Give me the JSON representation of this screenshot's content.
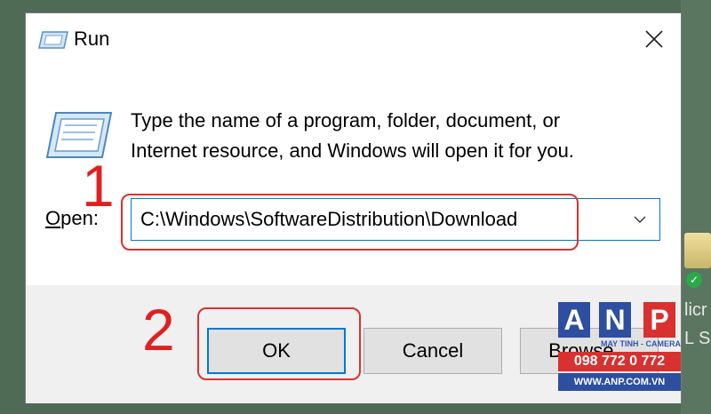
{
  "window": {
    "title": "Run",
    "description_line1": "Type the name of a program, folder, document, or",
    "description_line2": "Internet resource, and Windows will open it for you."
  },
  "open_field": {
    "label_accel": "O",
    "label_rest": "pen:",
    "value": "C:\\Windows\\SoftwareDistribution\\Download"
  },
  "buttons": {
    "ok": "OK",
    "cancel": "Cancel",
    "browse": "Browse..."
  },
  "annotations": {
    "step1": "1",
    "step2": "2",
    "highlight_color": "#e03030"
  },
  "desktop": {
    "text_line1": "licr",
    "text_line2": "L Se"
  },
  "watermark": {
    "letters": [
      "A",
      "N",
      "P"
    ],
    "letter_colors": [
      "#2e4fa0",
      "#2e4fa0",
      "#d93030"
    ],
    "subtitle": "MAY TINH - CAMERA",
    "phone": "098 772 0 772",
    "website": "WWW.ANP.COM.VN"
  },
  "icons": {
    "title": "run-app-icon",
    "dialog": "run-app-icon",
    "close": "close-icon",
    "dropdown": "chevron-down-icon"
  },
  "colors": {
    "accent": "#0078d7",
    "annotation": "#e02020"
  }
}
